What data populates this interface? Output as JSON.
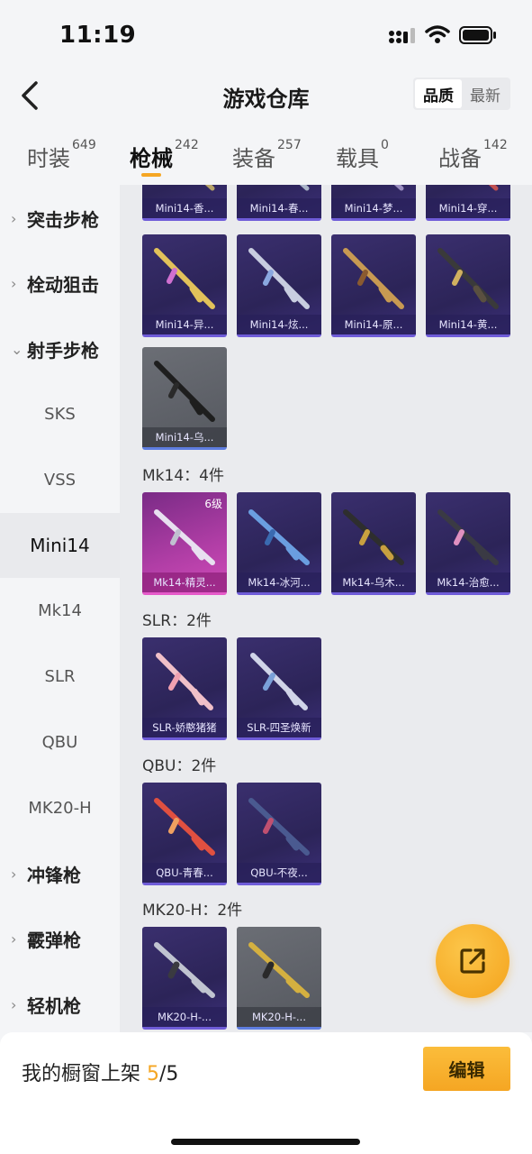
{
  "status_bar": {
    "time": "11:19"
  },
  "header": {
    "title": "游戏仓库",
    "sort_quality": "品质",
    "sort_newest": "最新"
  },
  "tabs": [
    {
      "label": "时装",
      "count": "649"
    },
    {
      "label": "枪械",
      "count": "242"
    },
    {
      "label": "装备",
      "count": "257"
    },
    {
      "label": "载具",
      "count": "0"
    },
    {
      "label": "战备",
      "count": "142"
    }
  ],
  "sidebar": {
    "items": [
      {
        "label": "突击步枪",
        "type": "category",
        "expanded": false
      },
      {
        "label": "栓动狙击",
        "type": "category",
        "expanded": false
      },
      {
        "label": "射手步枪",
        "type": "category",
        "expanded": true
      },
      {
        "label": "SKS",
        "type": "sub"
      },
      {
        "label": "VSS",
        "type": "sub"
      },
      {
        "label": "Mini14",
        "type": "sub",
        "active": true
      },
      {
        "label": "Mk14",
        "type": "sub"
      },
      {
        "label": "SLR",
        "type": "sub"
      },
      {
        "label": "QBU",
        "type": "sub"
      },
      {
        "label": "MK20-H",
        "type": "sub"
      },
      {
        "label": "冲锋枪",
        "type": "category",
        "expanded": false
      },
      {
        "label": "霰弹枪",
        "type": "category",
        "expanded": false
      },
      {
        "label": "轻机枪",
        "type": "category",
        "expanded": false
      }
    ]
  },
  "content": {
    "top_partial": [
      "Mini14-香...",
      "Mini14-春...",
      "Mini14-梦...",
      "Mini14-穿..."
    ],
    "mini14_row": [
      "Mini14-异...",
      "Mini14-炫...",
      "Mini14-原...",
      "Mini14-黄..."
    ],
    "mini14_last": "Mini14-乌...",
    "mk14_section": "Mk14：4件",
    "mk14": [
      "Mk14-精灵...",
      "Mk14-冰河...",
      "Mk14-乌木...",
      "Mk14-治愈..."
    ],
    "mk14_level": "6级",
    "slr_section": "SLR：2件",
    "slr": [
      "SLR-娇憨猪猪",
      "SLR-四圣焕新"
    ],
    "qbu_section": "QBU：2件",
    "qbu": [
      "QBU-青春...",
      "QBU-不夜..."
    ],
    "mk20_section": "MK20-H：2件",
    "mk20": [
      "MK20-H-...",
      "MK20-H-..."
    ]
  },
  "bottom_bar": {
    "label": "我的橱窗上架 ",
    "current": "5",
    "total": "/5",
    "edit_label": "编辑"
  },
  "colors": {
    "accent": "#f5a623",
    "card_purple": "#2c2458",
    "card_rare": "#b13ea6"
  }
}
